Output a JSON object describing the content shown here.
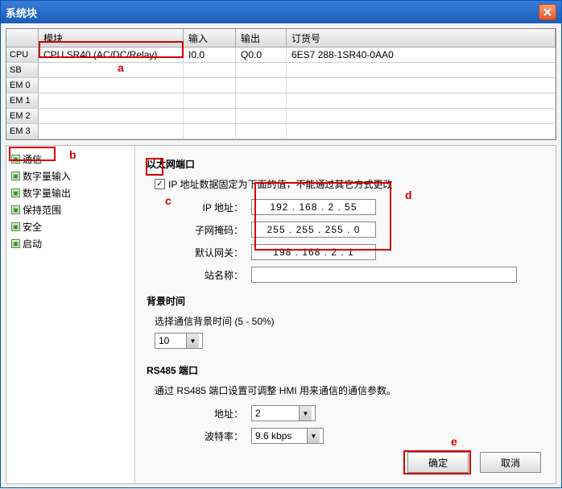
{
  "title": "系统块",
  "grid": {
    "headers": {
      "module": "模块",
      "input": "输入",
      "output": "输出",
      "order": "订货号"
    },
    "rows": [
      {
        "slot": "CPU",
        "module": "CPU SR40 (AC/DC/Relay)",
        "input": "I0.0",
        "output": "Q0.0",
        "order": "6ES7 288-1SR40-0AA0"
      },
      {
        "slot": "SB",
        "module": "",
        "input": "",
        "output": "",
        "order": ""
      },
      {
        "slot": "EM 0",
        "module": "",
        "input": "",
        "output": "",
        "order": ""
      },
      {
        "slot": "EM 1",
        "module": "",
        "input": "",
        "output": "",
        "order": ""
      },
      {
        "slot": "EM 2",
        "module": "",
        "input": "",
        "output": "",
        "order": ""
      },
      {
        "slot": "EM 3",
        "module": "",
        "input": "",
        "output": "",
        "order": ""
      }
    ]
  },
  "nav": {
    "items": [
      {
        "label": "通信"
      },
      {
        "label": "数字量输入"
      },
      {
        "label": "数字量输出"
      },
      {
        "label": "保持范围"
      },
      {
        "label": "安全"
      },
      {
        "label": "启动"
      }
    ]
  },
  "net": {
    "section_title": "以太网端口",
    "fix_label": "IP 地址数据固定为下面的值，不能通过其它方式更改",
    "fix_checked": "✓",
    "ip_label": "IP 地址：",
    "ip_value": "192 . 168 .  2  . 55",
    "mask_label": "子网掩码：",
    "mask_value": "255 . 255 . 255 .  0",
    "gw_label": "默认网关：",
    "gw_value": "198 . 168 .  2  .  1",
    "station_label": "站名称："
  },
  "bg": {
    "section_title": "背景时间",
    "desc": "选择通信背景时间 (5 - 50%)",
    "value": "10"
  },
  "rs485": {
    "section_title": "RS485 端口",
    "desc": "通过 RS485 端口设置可调整 HMI 用来通信的通信参数。",
    "addr_label": "地址：",
    "addr_value": "2",
    "baud_label": "波特率：",
    "baud_value": "9.6 kbps"
  },
  "buttons": {
    "ok": "确定",
    "cancel": "取消"
  },
  "annotations": {
    "a": "a",
    "b": "b",
    "c": "c",
    "d": "d",
    "e": "e"
  }
}
